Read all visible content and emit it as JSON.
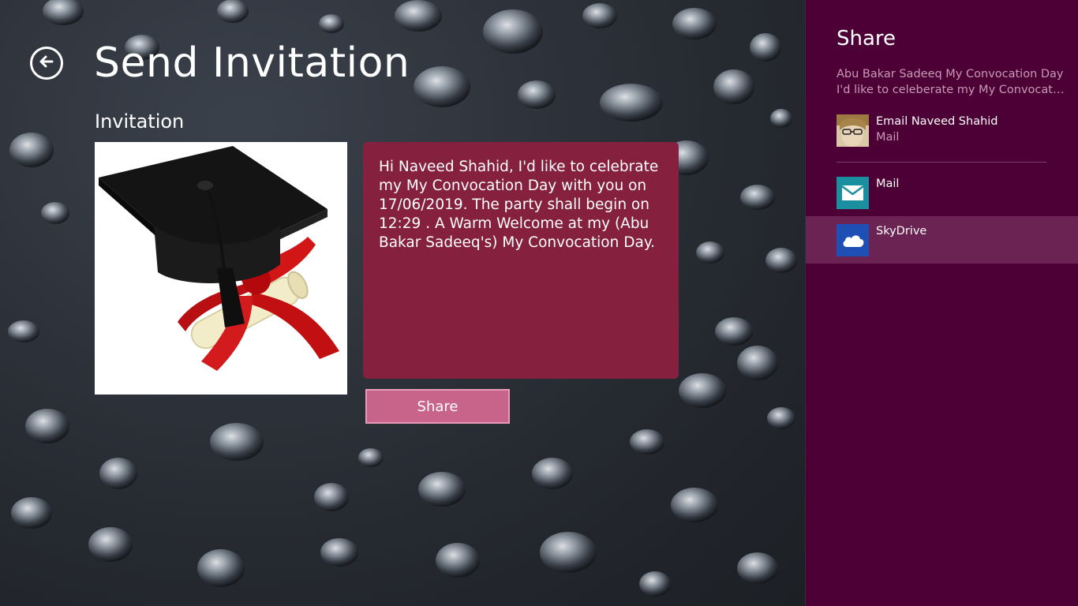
{
  "app": {
    "title": "Send Invitation",
    "section_title": "Invitation",
    "message": "Hi Naveed Shahid, I'd like to celebrate my My Convocation Day with you on 17/06/2019. The party shall begin on 12:29 . A Warm Welcome at my (Abu Bakar Sadeeq's) My Convocation Day.",
    "share_button_label": "Share",
    "colors": {
      "message_box": "#85203e",
      "share_button": "#c8648a",
      "share_pane": "#4c0035"
    }
  },
  "share_pane": {
    "heading": "Share",
    "description_line1": "Abu Bakar Sadeeq My Convocation Day",
    "description_line2": "I'd like to celeberate my My Convocati...",
    "contact": {
      "title": "Email Naveed Shahid",
      "subtitle": "Mail",
      "icon": "contact-avatar"
    },
    "apps": [
      {
        "title": "Mail",
        "icon": "mail-icon",
        "color": "#1a8fa0"
      },
      {
        "title": "SkyDrive",
        "icon": "skydrive-icon",
        "color": "#1e4fb5"
      }
    ]
  }
}
